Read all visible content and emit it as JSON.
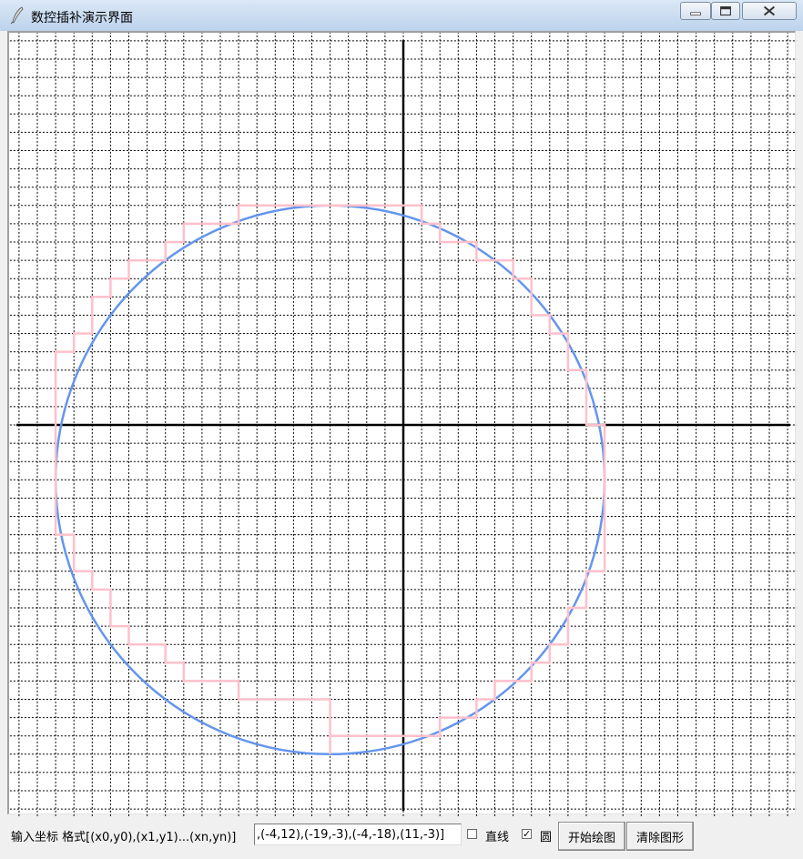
{
  "window": {
    "title": "数控插补演示界面",
    "icon": "feather-icon",
    "controls": [
      "minimize-icon",
      "maximize-icon",
      "close-icon"
    ]
  },
  "controls": {
    "input_label": "输入坐标 格式[(x0,y0),(x1,y1)...(xn,yn)]",
    "coords_value": ",(-4,12),(-19,-3),(-4,-18),(11,-3)]",
    "line_option": {
      "label": "直线",
      "checked": false
    },
    "circle_option": {
      "label": "圆",
      "checked": true
    },
    "start_button": "开始绘图",
    "clear_button": "清除图形"
  },
  "colors": {
    "grid": "#000000",
    "axes": "#000000",
    "circle": "#6495ed",
    "interpolation_path": "#ffc0cb"
  },
  "chart_data": {
    "type": "interpolation-plot",
    "grid": true,
    "grid_style": "dashed",
    "xlim": [
      -21,
      21
    ],
    "ylim": [
      -21,
      21
    ],
    "circle": {
      "center": [
        -4,
        -3
      ],
      "radius": 15
    },
    "interpolation_path": [
      [
        -4,
        12
      ],
      [
        -9,
        12
      ],
      [
        -9,
        11
      ],
      [
        -12,
        11
      ],
      [
        -12,
        10
      ],
      [
        -13,
        10
      ],
      [
        -13,
        9
      ],
      [
        -15,
        9
      ],
      [
        -15,
        8
      ],
      [
        -16,
        8
      ],
      [
        -16,
        7
      ],
      [
        -17,
        7
      ],
      [
        -17,
        5
      ],
      [
        -18,
        5
      ],
      [
        -18,
        4
      ],
      [
        -19,
        4
      ],
      [
        -19,
        -3
      ],
      [
        -19,
        -6
      ],
      [
        -18,
        -6
      ],
      [
        -18,
        -8
      ],
      [
        -17,
        -8
      ],
      [
        -17,
        -9
      ],
      [
        -16,
        -9
      ],
      [
        -16,
        -11
      ],
      [
        -15,
        -11
      ],
      [
        -15,
        -12
      ],
      [
        -13,
        -12
      ],
      [
        -13,
        -13
      ],
      [
        -12,
        -13
      ],
      [
        -12,
        -14
      ],
      [
        -9,
        -14
      ],
      [
        -9,
        -15
      ],
      [
        -4,
        -15
      ],
      [
        -4,
        -18
      ],
      [
        -4,
        -17
      ],
      [
        2,
        -17
      ],
      [
        2,
        -16
      ],
      [
        4,
        -16
      ],
      [
        4,
        -15
      ],
      [
        5,
        -15
      ],
      [
        5,
        -14
      ],
      [
        7,
        -14
      ],
      [
        7,
        -13
      ],
      [
        8,
        -13
      ],
      [
        8,
        -12
      ],
      [
        9,
        -12
      ],
      [
        9,
        -10
      ],
      [
        10,
        -10
      ],
      [
        10,
        -8
      ],
      [
        11,
        -8
      ],
      [
        11,
        -3
      ],
      [
        11,
        -3
      ],
      [
        11,
        0
      ],
      [
        10,
        0
      ],
      [
        10,
        3
      ],
      [
        9,
        3
      ],
      [
        9,
        5
      ],
      [
        8,
        5
      ],
      [
        8,
        6
      ],
      [
        7,
        6
      ],
      [
        7,
        8
      ],
      [
        6,
        8
      ],
      [
        6,
        9
      ],
      [
        4,
        9
      ],
      [
        4,
        10
      ],
      [
        2,
        10
      ],
      [
        2,
        11
      ],
      [
        1,
        11
      ],
      [
        1,
        12
      ],
      [
        -4,
        12
      ]
    ]
  }
}
